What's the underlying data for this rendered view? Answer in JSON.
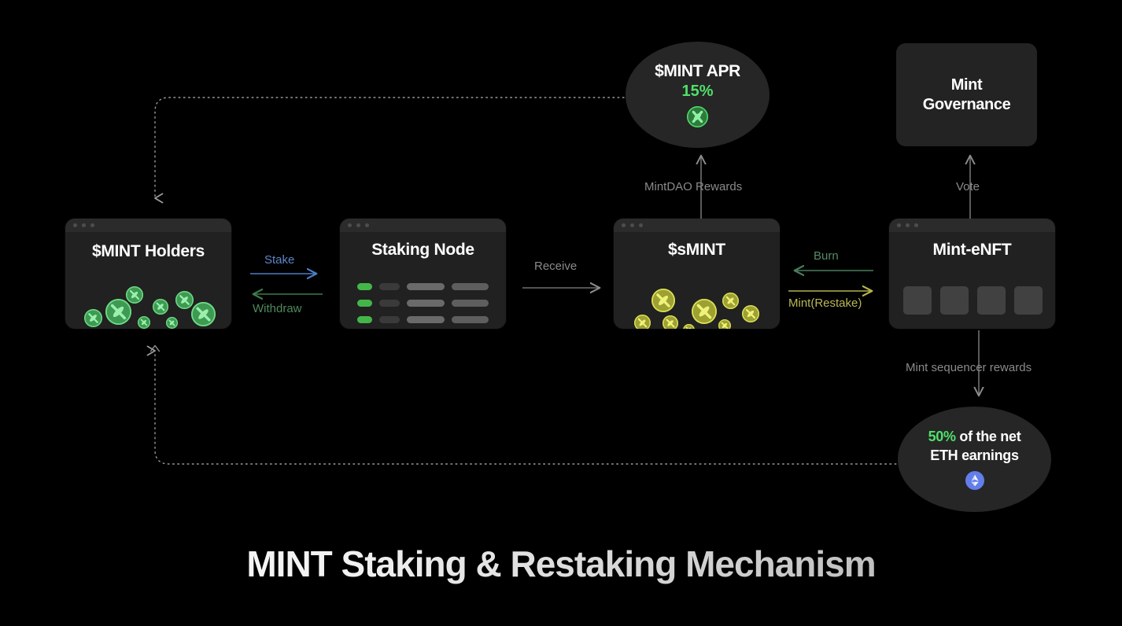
{
  "footer": {
    "title": "MINT Staking & Restaking Mechanism"
  },
  "colors": {
    "background": "#000000",
    "card": "#212121",
    "card_bar": "#2b2b2b",
    "accent_green": "#4ee06a",
    "stake_blue": "#3f6fb5",
    "withdraw_green": "#3f7a4c",
    "burn_green": "#4a7d5c",
    "mint_yellow": "#b5b34a",
    "receive_gray": "#6e6e6e",
    "coin_green": "#4aa85e",
    "coin_yellow": "#b5b93c",
    "eth_blue": "#627eea"
  },
  "nodes": {
    "apr": {
      "title": "$MINT APR",
      "value": "15%",
      "badge_icon": "mint-token-icon"
    },
    "governance": {
      "line1": "Mint",
      "line2": "Governance"
    },
    "holders": {
      "title": "$MINT Holders"
    },
    "staking_node": {
      "title": "Staking Node",
      "rows": 3
    },
    "smint": {
      "title": "$sMINT"
    },
    "enft": {
      "title": "Mint-eNFT",
      "squares": 4
    },
    "eth_earnings": {
      "percent": "50%",
      "text_rest": " of the net",
      "line2": "ETH earnings",
      "badge_icon": "ethereum-icon"
    }
  },
  "edges": {
    "stake": "Stake",
    "withdraw": "Withdraw",
    "receive": "Receive",
    "burn": "Burn",
    "mint_restake": "Mint(Restake)",
    "mintdao_rewards": "MintDAO Rewards",
    "vote": "Vote",
    "sequencer_rewards": "Mint sequencer rewards"
  }
}
